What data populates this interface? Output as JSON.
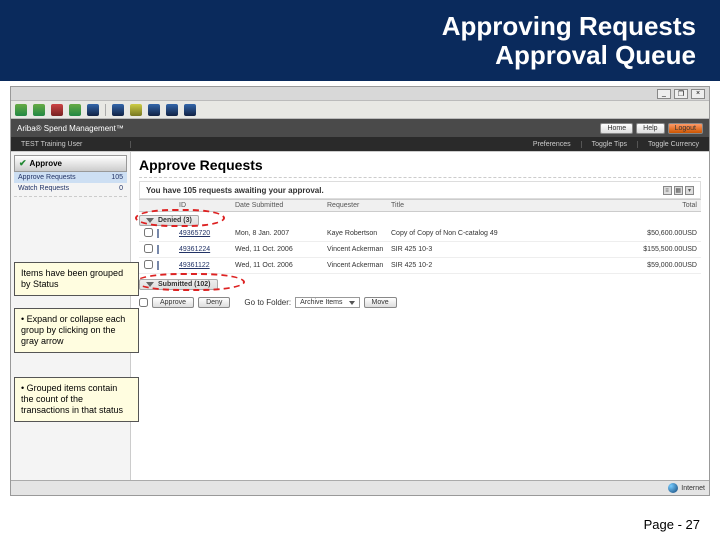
{
  "slide": {
    "title1": "Approving Requests",
    "title2": "Approval Queue"
  },
  "window": {
    "min": "_",
    "restore": "❐",
    "close": "×"
  },
  "ariba": {
    "brand": "Ariba® Spend Management™",
    "nav": {
      "home": "Home",
      "help": "Help",
      "logout": "Logout"
    }
  },
  "darkmenu": {
    "user": "TEST Training User",
    "prefs": "Preferences",
    "tips": "Toggle Tips",
    "curr": "Toggle Currency"
  },
  "sidebar": {
    "head": "Approve",
    "items": [
      {
        "label": "Approve Requests",
        "count": "105"
      },
      {
        "label": "Watch Requests",
        "count": "0"
      }
    ]
  },
  "page": {
    "heading": "Approve Requests",
    "await": "You have 105 requests awaiting your approval.",
    "cols": {
      "id": "ID",
      "date": "Date Submitted",
      "req": "Requester",
      "title": "Title",
      "total": "Total"
    },
    "groups": {
      "denied": "Denied (3)",
      "submitted": "Submitted (102)"
    },
    "rows": [
      {
        "id": "49365720",
        "date": "Mon, 8 Jan. 2007",
        "req": "Kaye Robertson",
        "title": "Copy of Copy of Non C-catalog 49",
        "total": "$50,600.00USD"
      },
      {
        "id": "49361224",
        "date": "Wed, 11 Oct. 2006",
        "req": "Vincent Ackerman",
        "title": "SIR 425 10-3",
        "total": "$155,500.00USD"
      },
      {
        "id": "49361122",
        "date": "Wed, 11 Oct. 2006",
        "req": "Vincent Ackerman",
        "title": "SIR 425 10-2",
        "total": "$59,000.00USD"
      }
    ],
    "actions": {
      "approve": "Approve",
      "deny": "Deny",
      "goto_lbl": "Go to Folder:",
      "goto_val": "Archive Items",
      "move": "Move"
    }
  },
  "callouts": {
    "c1": "Items have been grouped by Status",
    "c2": "• Expand or collapse each group by clicking on the gray arrow",
    "c3": "• Grouped items contain the count of the transactions in that status"
  },
  "status": {
    "internet": "Internet"
  },
  "footer": {
    "page": "Page - 27"
  }
}
